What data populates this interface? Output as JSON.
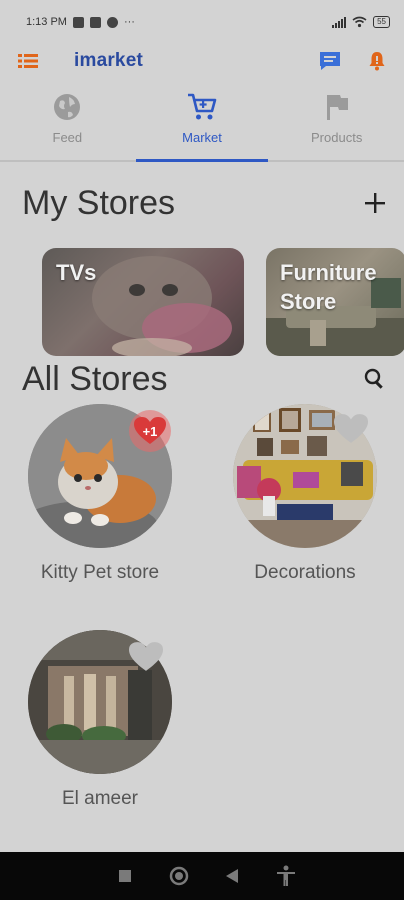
{
  "status_bar": {
    "time": "1:13 PM",
    "more": "···",
    "battery": "55"
  },
  "app_bar": {
    "title": "imarket",
    "menu_icon": "list-icon",
    "chat_icon": "chat-icon",
    "notification_icon": "bell-icon",
    "colors": {
      "brand": "#2a4a9f",
      "accent": "#e0651a",
      "chat": "#3a6fd8"
    }
  },
  "tabs": [
    {
      "label": "Feed",
      "icon": "globe-icon",
      "active": false
    },
    {
      "label": "Market",
      "icon": "cart-icon",
      "active": true
    },
    {
      "label": "Products",
      "icon": "flag-icon",
      "active": false
    }
  ],
  "my_stores": {
    "title": "My Stores",
    "add_icon": "plus-icon",
    "cards": [
      {
        "label": "TVs"
      },
      {
        "label": "Furniture Store"
      }
    ]
  },
  "all_stores": {
    "title": "All Stores",
    "search_icon": "search-icon",
    "stores": [
      {
        "name": "Kitty Pet store",
        "liked": true,
        "like_badge": "+1"
      },
      {
        "name": "Decorations",
        "liked": false
      },
      {
        "name": "El ameer",
        "liked": false
      }
    ]
  },
  "nav_bar": {
    "buttons": [
      "recents-button",
      "home-button",
      "back-button",
      "accessibility-button"
    ]
  }
}
